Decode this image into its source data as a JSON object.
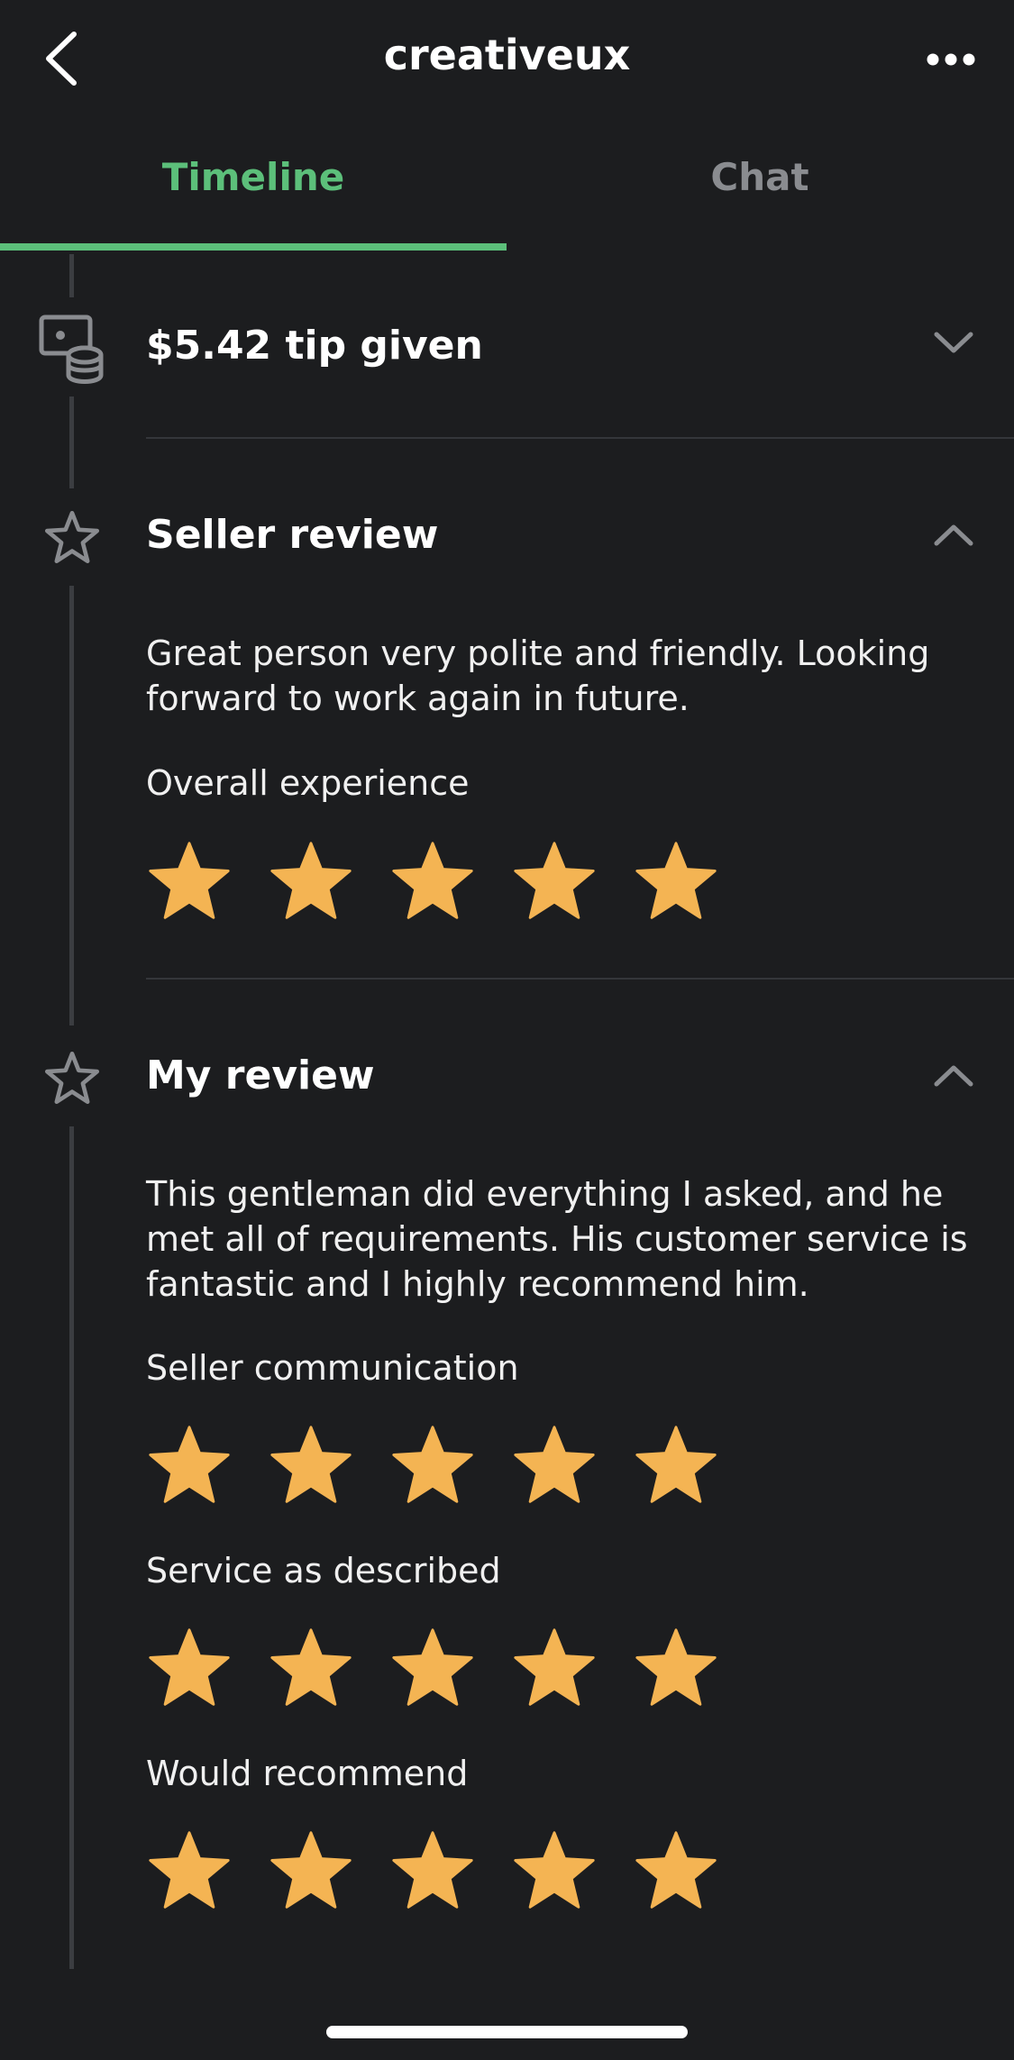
{
  "header": {
    "title": "creativeux"
  },
  "tabs": [
    {
      "label": "Timeline",
      "active": true
    },
    {
      "label": "Chat",
      "active": false
    }
  ],
  "timeline": {
    "tip": {
      "title": "$5.42 tip given",
      "expanded": false
    },
    "seller_review": {
      "title": "Seller review",
      "expanded": true,
      "text": "Great person very polite and friendly. Looking forward to work again in future.",
      "ratings": [
        {
          "label": "Overall experience",
          "stars": 5,
          "max": 5
        }
      ]
    },
    "my_review": {
      "title": "My review",
      "expanded": true,
      "text": "This gentleman did everything I asked, and he met all of requirements. His customer service is fantastic and I highly recommend him.",
      "ratings": [
        {
          "label": "Seller communication",
          "stars": 5,
          "max": 5
        },
        {
          "label": "Service as described",
          "stars": 5,
          "max": 5
        },
        {
          "label": "Would recommend",
          "stars": 5,
          "max": 5
        }
      ]
    }
  },
  "colors": {
    "accent": "#5cbf7a",
    "star": "#f4b453",
    "background": "#1c1d1f",
    "muted": "#8a8c90"
  },
  "icons": [
    "back-arrow-icon",
    "more-icon",
    "tip-coins-icon",
    "star-outline-icon",
    "chevron-down-icon",
    "chevron-up-icon",
    "star-icon"
  ]
}
